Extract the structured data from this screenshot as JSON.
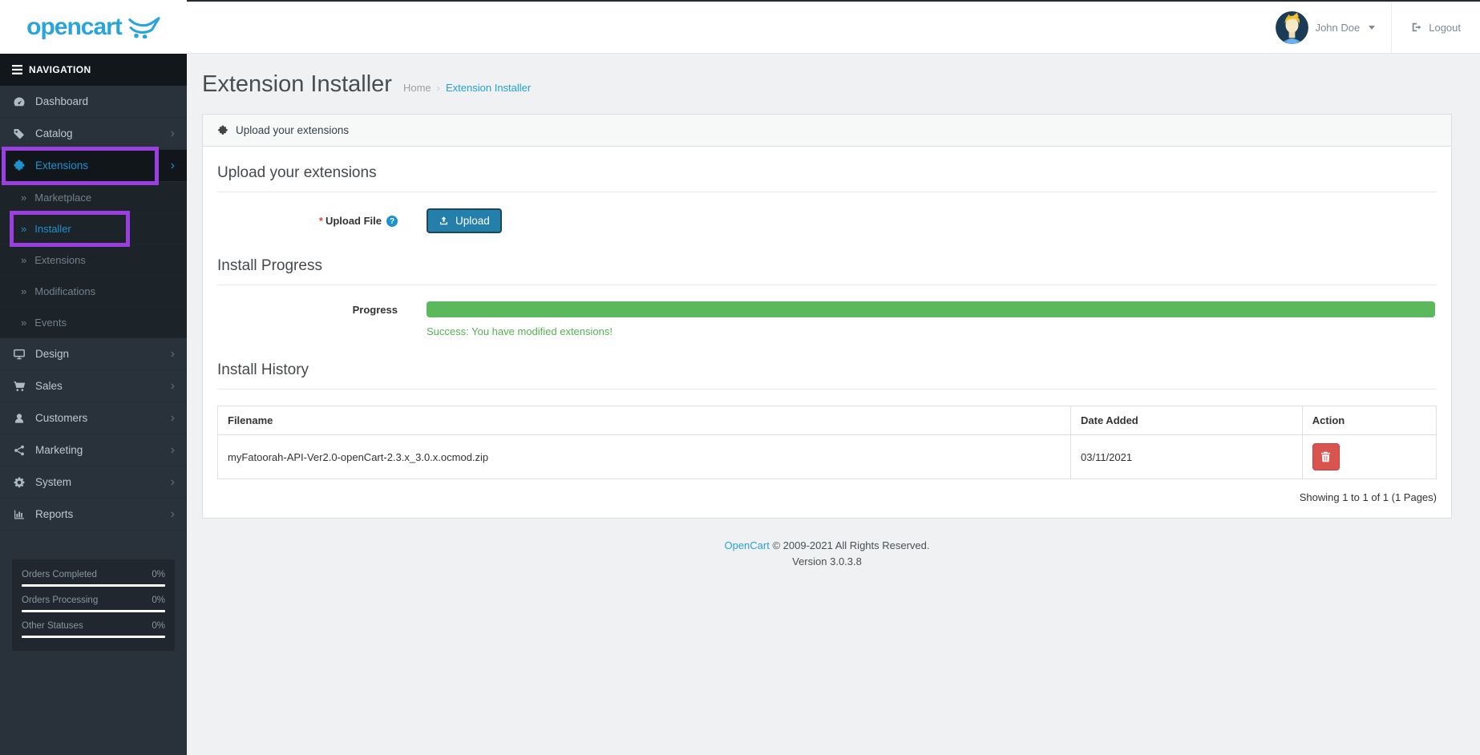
{
  "colors": {
    "accent_blue": "#1e91cf",
    "logo_blue": "#29a5dc",
    "success_green": "#5cb85c",
    "danger_red": "#d9534f",
    "highlight_purple": "#9b3fe0",
    "sidebar_dark": "#29323b"
  },
  "glyphs": {
    "submenu_arrow": "»",
    "parent_chevron": "›",
    "breadcrumb_separator": "›",
    "help": "?"
  },
  "header": {
    "logo_text": "opencart",
    "user_name": "John Doe",
    "logout_label": "Logout"
  },
  "sidebar": {
    "nav_header": "NAVIGATION",
    "menu": [
      {
        "label": "Dashboard"
      },
      {
        "label": "Catalog"
      },
      {
        "label": "Extensions"
      },
      {
        "label": "Marketplace"
      },
      {
        "label": "Installer"
      },
      {
        "label": "Extensions"
      },
      {
        "label": "Modifications"
      },
      {
        "label": "Events"
      },
      {
        "label": "Design"
      },
      {
        "label": "Sales"
      },
      {
        "label": "Customers"
      },
      {
        "label": "Marketing"
      },
      {
        "label": "System"
      },
      {
        "label": "Reports"
      }
    ],
    "stats": [
      {
        "label": "Orders Completed",
        "value": "0%"
      },
      {
        "label": "Orders Processing",
        "value": "0%"
      },
      {
        "label": "Other Statuses",
        "value": "0%"
      }
    ]
  },
  "page": {
    "title": "Extension Installer",
    "breadcrumbs": [
      {
        "label": "Home"
      },
      {
        "label": "Extension Installer"
      }
    ]
  },
  "panel": {
    "heading": "Upload your extensions",
    "upload": {
      "section_title": "Upload your extensions",
      "required_mark": "*",
      "field_label": "Upload File",
      "button_label": "Upload"
    },
    "progress": {
      "section_title": "Install Progress",
      "row_label": "Progress",
      "percent": 100,
      "success_message": "Success: You have modified extensions!"
    },
    "history": {
      "section_title": "Install History",
      "columns": {
        "filename": "Filename",
        "date_added": "Date Added",
        "action": "Action"
      },
      "rows": [
        {
          "filename": "myFatoorah-API-Ver2.0-openCart-2.3.x_3.0.x.ocmod.zip",
          "date_added": "03/11/2021"
        }
      ],
      "showing_text": "Showing 1 to 1 of 1 (1 Pages)"
    }
  },
  "footer": {
    "link_text": "OpenCart",
    "copyright_text": "© 2009-2021 All Rights Reserved.",
    "version_text": "Version 3.0.3.8"
  }
}
